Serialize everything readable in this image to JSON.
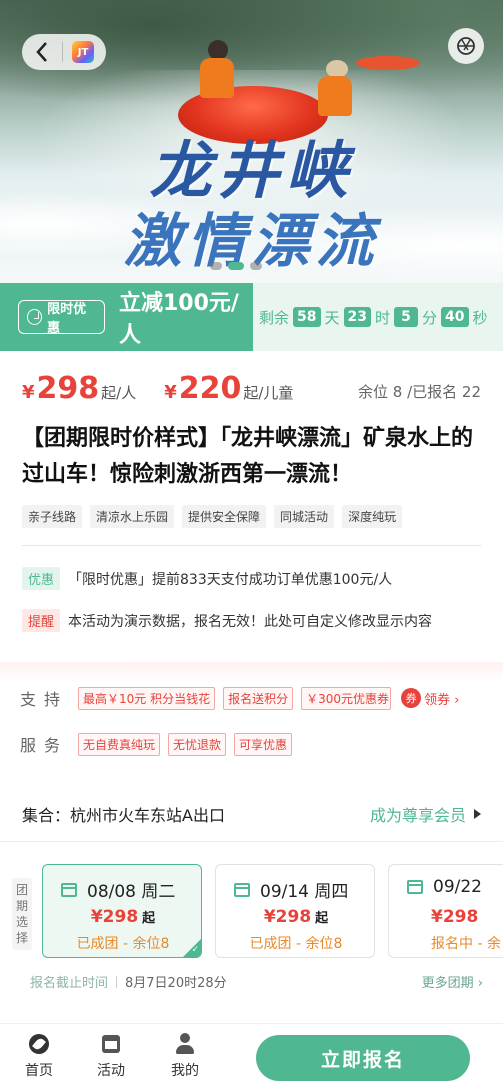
{
  "hero": {
    "title_line1": "龙井峡",
    "title_line2": "激情漂流",
    "home_icon_text": "JT"
  },
  "promo": {
    "badge": "限时优惠",
    "discount": "立减100元/人",
    "remaining_label": "剩余",
    "days": "58",
    "days_unit": "天",
    "hours": "23",
    "hours_unit": "时",
    "minutes": "5",
    "minutes_unit": "分",
    "seconds": "40",
    "seconds_unit": "秒"
  },
  "price": {
    "currency": "¥",
    "adult": "298",
    "adult_unit": "起/人",
    "child": "220",
    "child_unit": "起/儿童",
    "stock": "余位 8  /已报名 22"
  },
  "title": "【团期限时价样式】「龙井峡漂流」矿泉水上的过山车！惊险刺激浙西第一漂流！",
  "tags": [
    "亲子线路",
    "清凉水上乐园",
    "提供安全保障",
    "同城活动",
    "深度纯玩"
  ],
  "notes": {
    "discount_label": "优惠",
    "discount_text": "「限时优惠」提前833天支付成功订单优惠100元/人",
    "remind_label": "提醒",
    "remind_text": "本活动为演示数据，报名无效！此处可自定义修改显示内容"
  },
  "service": {
    "support_label": "支持",
    "support_tags": [
      "最高￥10元 积分当钱花",
      "报名送积分",
      "￥300元优惠券"
    ],
    "coupon_icon": "券",
    "coupon_label": "领券 ›",
    "service_label": "服务",
    "service_tags": [
      "无自费真纯玩",
      "无忧退款",
      "可享优惠"
    ]
  },
  "meeting": {
    "text": "集合：杭州市火车东站A出口",
    "vip": "成为尊享会员"
  },
  "groups": {
    "label": "团期选择",
    "cards": [
      {
        "date": "08/08 周二",
        "price": "¥298",
        "qi": "起",
        "status": "已成团 - 余位8"
      },
      {
        "date": "09/14 周四",
        "price": "¥298",
        "qi": "起",
        "status": "已成团 - 余位8"
      },
      {
        "date": "09/22",
        "price": "¥298",
        "qi": "",
        "status": "报名中 - 余"
      }
    ],
    "deadline_label": "报名截止时间",
    "deadline_value": "8月7日20时28分",
    "more": "更多团期 ›"
  },
  "tabbar": {
    "home": "首页",
    "activity": "活动",
    "mine": "我的",
    "signup": "立即报名"
  },
  "colors": {
    "accent": "#4fb890",
    "price": "#e8423a"
  }
}
